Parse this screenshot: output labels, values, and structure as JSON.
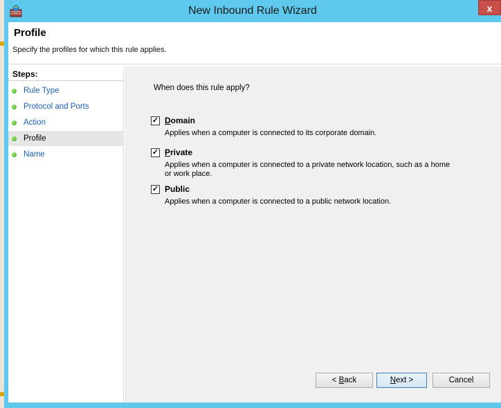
{
  "window": {
    "title": "New Inbound Rule Wizard",
    "close_label": "x"
  },
  "header": {
    "title": "Profile",
    "subtitle": "Specify the profiles for which this rule applies."
  },
  "steps": {
    "heading": "Steps:",
    "items": [
      {
        "label": "Rule Type",
        "current": false
      },
      {
        "label": "Protocol and Ports",
        "current": false
      },
      {
        "label": "Action",
        "current": false
      },
      {
        "label": "Profile",
        "current": true
      },
      {
        "label": "Name",
        "current": false
      }
    ]
  },
  "main": {
    "question": "When does this rule apply?",
    "options": [
      {
        "key": "D",
        "rest": "omain",
        "checked": true,
        "description": "Applies when a computer is connected to its corporate domain."
      },
      {
        "key": "P",
        "rest": "rivate",
        "checked": true,
        "description": "Applies when a computer is connected to a private network location, such as a home or work place."
      },
      {
        "key": "Pu",
        "rest": "blic",
        "checked": true,
        "description": "Applies when a computer is connected to a public network location."
      }
    ]
  },
  "buttons": {
    "back": {
      "mn": "B",
      "rest": "ack",
      "prefix": "< "
    },
    "next": {
      "mn": "N",
      "rest": "ext >"
    },
    "cancel": "Cancel"
  },
  "colors": {
    "accent": "#5ec9ec",
    "close": "#c7514a",
    "step_link": "#1c5fb2"
  }
}
